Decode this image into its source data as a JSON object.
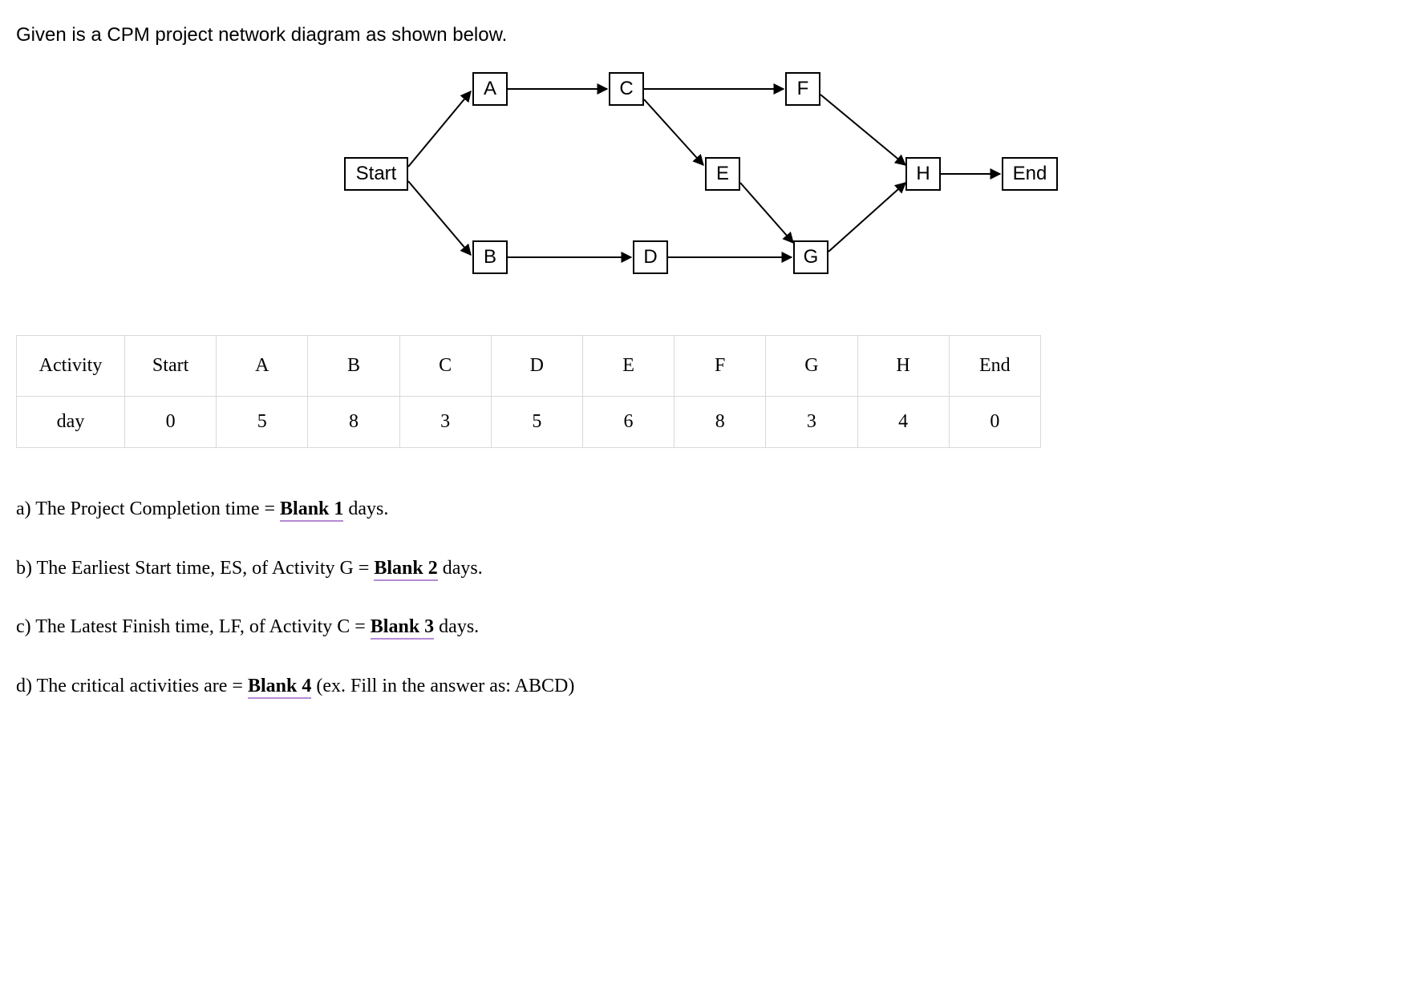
{
  "intro": "Given is a CPM project network diagram as shown below.",
  "nodes": {
    "start": "Start",
    "a": "A",
    "b": "B",
    "c": "C",
    "d": "D",
    "e": "E",
    "f": "F",
    "g": "G",
    "h": "H",
    "end": "End"
  },
  "table": {
    "row_activity_label": "Activity",
    "row_day_label": "day",
    "headers": [
      "Start",
      "A",
      "B",
      "C",
      "D",
      "E",
      "F",
      "G",
      "H",
      "End"
    ],
    "days": [
      "0",
      "5",
      "8",
      "3",
      "5",
      "6",
      "8",
      "3",
      "4",
      "0"
    ]
  },
  "questions": {
    "a_pre": "a) The Project Completion time = ",
    "a_blank": "Blank 1",
    "a_post": " days.",
    "b_pre": "b) The Earliest Start time, ES, of Activity G = ",
    "b_blank": "Blank 2",
    "b_post": " days.",
    "c_pre": "c) The Latest Finish time, LF, of Activity C = ",
    "c_blank": "Blank 3",
    "c_post": " days.",
    "d_pre": "d) The critical activities are = ",
    "d_blank": "Blank 4",
    "d_post": " (ex. Fill in the answer as: ABCD)"
  },
  "chart_data": {
    "type": "table",
    "title": "CPM project network diagram with activity durations",
    "nodes": [
      "Start",
      "A",
      "B",
      "C",
      "D",
      "E",
      "F",
      "G",
      "H",
      "End"
    ],
    "durations_days": {
      "Start": 0,
      "A": 5,
      "B": 8,
      "C": 3,
      "D": 5,
      "E": 6,
      "F": 8,
      "G": 3,
      "H": 4,
      "End": 0
    },
    "edges": [
      [
        "Start",
        "A"
      ],
      [
        "Start",
        "B"
      ],
      [
        "A",
        "C"
      ],
      [
        "B",
        "D"
      ],
      [
        "C",
        "E"
      ],
      [
        "C",
        "F"
      ],
      [
        "D",
        "G"
      ],
      [
        "E",
        "G"
      ],
      [
        "F",
        "H"
      ],
      [
        "G",
        "H"
      ],
      [
        "H",
        "End"
      ]
    ]
  }
}
